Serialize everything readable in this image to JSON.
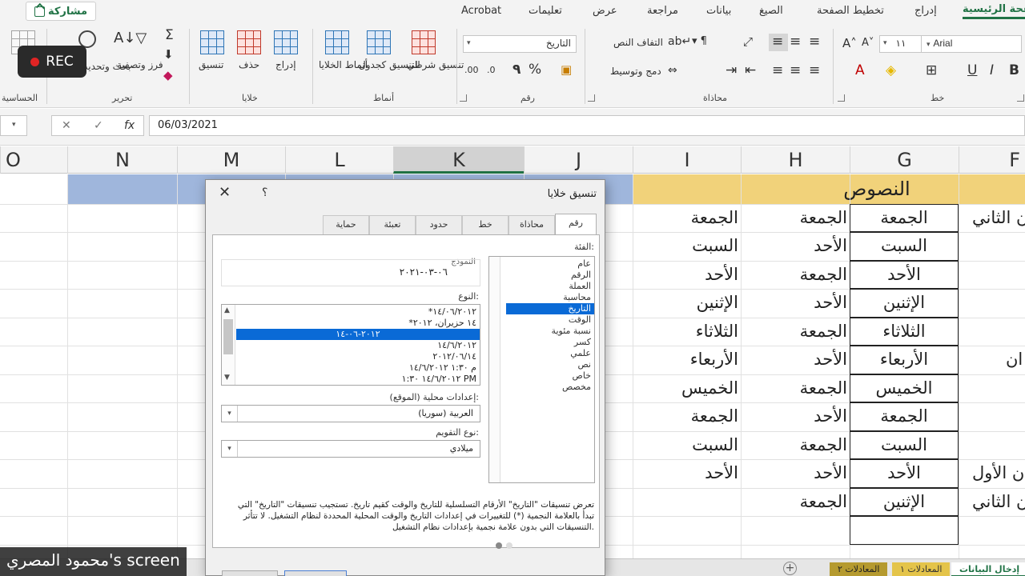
{
  "ribbon_tabs": {
    "share": "مشاركة",
    "items": [
      "الصفحة الرئيسية",
      "إدراج",
      "تخطيط الصفحة",
      "الصيغ",
      "بيانات",
      "مراجعة",
      "عرض",
      "تعليمات",
      "Acrobat"
    ]
  },
  "ribbon": {
    "groups": [
      "خط",
      "محاذاة",
      "رقم",
      "أنماط",
      "خلايا",
      "تحرير",
      "الحساسية"
    ],
    "font_name": "Arial",
    "font_size": "١١",
    "number_format": "التاريخ",
    "wrap_text": "التفاف النص",
    "merge_center": "دمج وتوسيط",
    "percent": "%",
    "comma": "٩",
    "cond_format": "تنسيق شرطي",
    "format_table": "التنسيق كجدول",
    "cell_styles": "أنماط الخلايا",
    "insert": "إدراج",
    "delete": "حذف",
    "format": "تنسيق",
    "sort_filter": "فرز وتصفية",
    "find_select": "بحث وتحديد",
    "rec": "REC"
  },
  "formula_bar": {
    "fx": "fx",
    "value": "06/03/2021"
  },
  "columns": {
    "headers": [
      "O",
      "N",
      "M",
      "L",
      "K",
      "J",
      "I",
      "H",
      "G",
      "F"
    ],
    "selected": "K"
  },
  "sheet": {
    "band_title": "النصوص",
    "col_i": [
      "الجمعة",
      "السبت",
      "الأحد",
      "الإثنين",
      "الثلاثاء",
      "الأربعاء",
      "الخميس",
      "الجمعة",
      "السبت",
      "الأحد"
    ],
    "col_h": [
      "الجمعة",
      "الأحد",
      "الجمعة",
      "الأحد",
      "الجمعة",
      "الأحد",
      "الجمعة",
      "الأحد",
      "الجمعة",
      "الأحد",
      "الجمعة"
    ],
    "col_g": [
      "الجمعة",
      "السبت",
      "الأحد",
      "الإثنين",
      "الثلاثاء",
      "الأربعاء",
      "الخميس",
      "الجمعة",
      "السبت",
      "الأحد",
      "الإثنين"
    ],
    "col_f": [
      "ن الثاني",
      "ان",
      "ن الأول",
      "ن الثاني"
    ]
  },
  "sheet_tabs": [
    "إدخال البيانات",
    "المعادلات",
    "المعادلات ١",
    "المعادلات ٢"
  ],
  "watermark": "محمود المصري's screen",
  "dialog": {
    "title": "تنسيق خلايا",
    "help": "؟",
    "close": "✕",
    "tabs": [
      "رقم",
      "محاذاة",
      "خط",
      "حدود",
      "تعبئة",
      "حماية"
    ],
    "category_label": "الفئة:",
    "categories": [
      "عام",
      "الرقم",
      "العملة",
      "محاسبة",
      "التاريخ",
      "الوقت",
      "نسبة مئوية",
      "كسر",
      "علمي",
      "نص",
      "خاص",
      "مخصص"
    ],
    "selected_category": "التاريخ",
    "sample_label": "النموذج",
    "sample_value": "٠٦-٠٣-٢٠٢١",
    "type_label": "النوع:",
    "types": [
      "*١٤/٠٦/٢٠١٢",
      "*١٤ حزيران، ٢٠١٢",
      "٢٠١٢-٠٦-١٤",
      "١٤/٦/٢٠١٢",
      "٢٠١٢/٠٦/١٤",
      "م ١:٣٠ ١٤/٦/٢٠١٢",
      "١٤/٦/٢٠١٢ ١:٣٠ PM"
    ],
    "selected_type": "٢٠١٢-٠٦-١٤",
    "locale_label": "إعدادات محلية (الموقع):",
    "locale_value": "العربية (سوريا)",
    "calendar_label": "نوع التقويم:",
    "calendar_value": "ميلادي",
    "description": "تعرض تنسيقات \"التاريخ\" الأرقام التسلسلية للتاريخ والوقت كقيم تاريخ. تستجيب تنسيقات \"التاريخ\" التي تبدأ بالعلامة النجمية (*) للتغييرات في إعدادات التاريخ والوقت المحلية المحددة لنظام التشغيل. لا تتأثر التنسيقات التي بدون علامة نجمية بإعدادات نظام التشغيل."
  }
}
